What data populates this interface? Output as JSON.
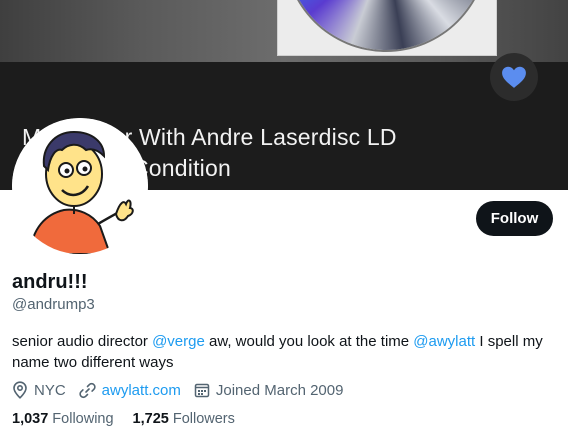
{
  "banner": {
    "caption_line1": "My Mentor With Andre Laserdisc LD",
    "caption_line2": "Condition",
    "heart_icon": "heart-icon",
    "heart_color": "#5b8def"
  },
  "profile": {
    "display_name": "andru!!!",
    "handle": "@andrump3",
    "follow_label": "Follow",
    "bio": {
      "text1": "senior audio director ",
      "mention1": "@verge",
      "text2": " aw, would you look at the time ",
      "mention2": "@awylatt",
      "text3": " I spell my name two different ways"
    },
    "location": "NYC",
    "website": "awylatt.com",
    "joined": "Joined March 2009",
    "following_count": "1,037",
    "following_label": "Following",
    "followers_count": "1,725",
    "followers_label": "Followers"
  },
  "colors": {
    "link": "#1d9bf0",
    "text": "#0f1419",
    "muted": "#536471",
    "button_bg": "#0f1419"
  }
}
